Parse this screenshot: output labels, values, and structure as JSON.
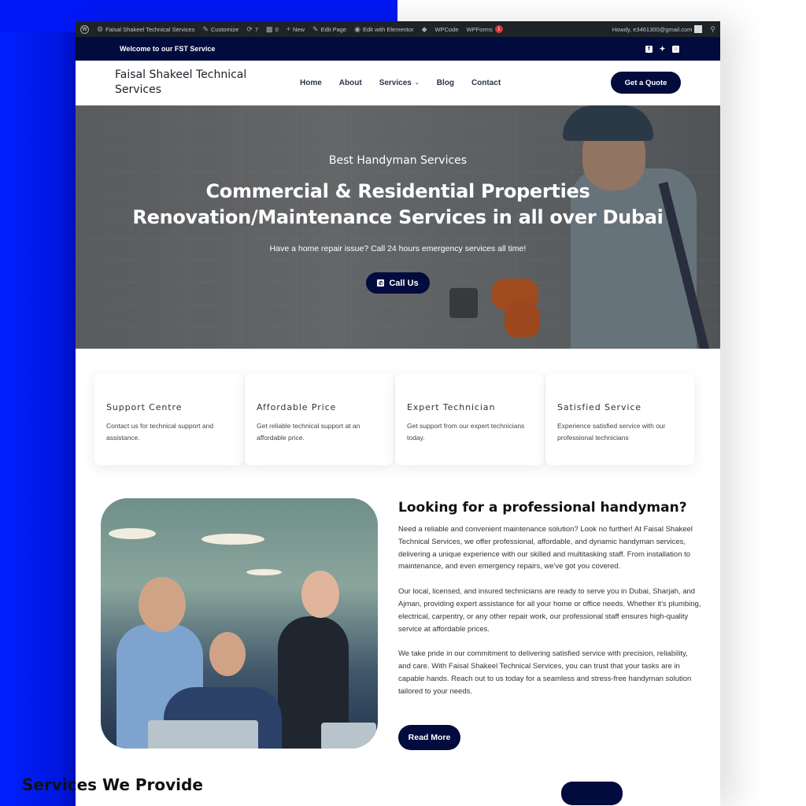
{
  "adminbar": {
    "site_name": "Faisal Shakeel Technical Services",
    "customize": "Customize",
    "updates_count": "7",
    "comments_count": "0",
    "new": "New",
    "edit_page": "Edit Page",
    "edit_elementor": "Edit with Elementor",
    "wpcode": "WPCode",
    "wpforms": "WPForms",
    "wpforms_badge": "1",
    "howdy": "Howdy, e3461300@gmail.com"
  },
  "topbar": {
    "welcome": "Welcome to our FST Service",
    "socials": [
      "facebook",
      "twitter",
      "instagram"
    ]
  },
  "header": {
    "logo": "Faisal Shakeel Technical Services",
    "nav": [
      {
        "label": "Home"
      },
      {
        "label": "About"
      },
      {
        "label": "Services",
        "has_dropdown": true
      },
      {
        "label": "Blog"
      },
      {
        "label": "Contact"
      }
    ],
    "cta": "Get a Quote"
  },
  "hero": {
    "eyebrow": "Best Handyman Services",
    "title_line1": "Commercial & Residential Properties",
    "title_line2": "Renovation/Maintenance Services in all over Dubai",
    "subtitle": "Have a home repair issue? Call 24 hours emergency services all time!",
    "button": "Call Us"
  },
  "features": [
    {
      "title": "Support Centre",
      "text": "Contact us for technical support and assistance."
    },
    {
      "title": "Affordable Price",
      "text": "Get reliable technical support at an affordable price."
    },
    {
      "title": "Expert Technician",
      "text": "Get support from our expert technicians today."
    },
    {
      "title": "Satisfied Service",
      "text": "Experience satisfied service with our professional technicians"
    }
  ],
  "about": {
    "heading": "Looking for a professional handyman?",
    "paragraphs": [
      "Need a reliable and convenient maintenance solution? Look no further! At Faisal Shakeel Technical Services, we offer professional, affordable, and dynamic handyman services, delivering a unique experience with our skilled and multitasking staff. From installation to maintenance, and even emergency repairs, we've got you covered.",
      "Our local, licensed, and insured technicians are ready to serve you in Dubai, Sharjah, and Ajman, providing expert assistance for all your home or office needs. Whether it's plumbing, electrical, carpentry, or any other repair work, our professional staff ensures high-quality service at affordable prices.",
      "We take pride in our commitment to delivering satisfied service with precision, reliability, and care. With Faisal Shakeel Technical Services, you can trust that your tasks are in capable hands. Reach out to us today for a seamless and stress-free handyman solution tailored to your needs."
    ],
    "button": "Read More"
  },
  "services": {
    "heading": "Services We Provide"
  },
  "colors": {
    "primary_navy": "#020b3d",
    "background_blue": "#0018f5",
    "adminbar": "#1d2327"
  }
}
